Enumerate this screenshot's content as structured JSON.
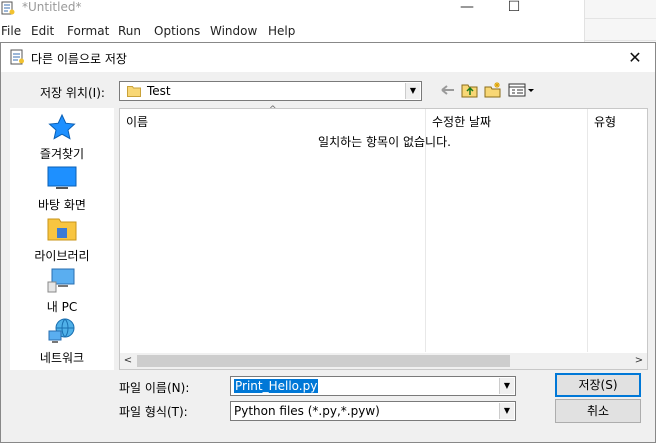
{
  "background_window": {
    "title": "*Untitled*",
    "menu": [
      "File",
      "Edit",
      "Format",
      "Run",
      "Options",
      "Window",
      "Help"
    ],
    "minimize_glyph": "—",
    "maximize_glyph": "☐"
  },
  "dialog": {
    "title": "다른 이름으로 저장",
    "close_glyph": "✕",
    "look_in_label": "저장 위치(I):",
    "look_in_value": "Test",
    "toolbar_icons": [
      "back-icon",
      "up-folder-icon",
      "new-folder-icon",
      "view-menu-icon"
    ],
    "places": [
      {
        "label": "즐겨찾기",
        "icon": "star-icon"
      },
      {
        "label": "바탕 화면",
        "icon": "desktop-icon"
      },
      {
        "label": "라이브러리",
        "icon": "library-icon"
      },
      {
        "label": "내 PC",
        "icon": "computer-icon"
      },
      {
        "label": "네트워크",
        "icon": "network-icon"
      }
    ],
    "columns": [
      "이름",
      "수정한 날짜",
      "유형"
    ],
    "empty_message": "일치하는 항목이 없습니다.",
    "filename_label": "파일 이름(N):",
    "filename_value": "Print_Hello.py",
    "filetype_label": "파일 형식(T):",
    "filetype_value": "Python files (*.py,*.pyw)",
    "save_button": "저장(S)",
    "cancel_button": "취소",
    "scroll_left": "<",
    "scroll_right": ">",
    "sort_caret": "^"
  },
  "colors": {
    "selection": "#0078d7",
    "dialog_bg": "#f0f0f0",
    "accent_blue": "#1e90ff"
  }
}
